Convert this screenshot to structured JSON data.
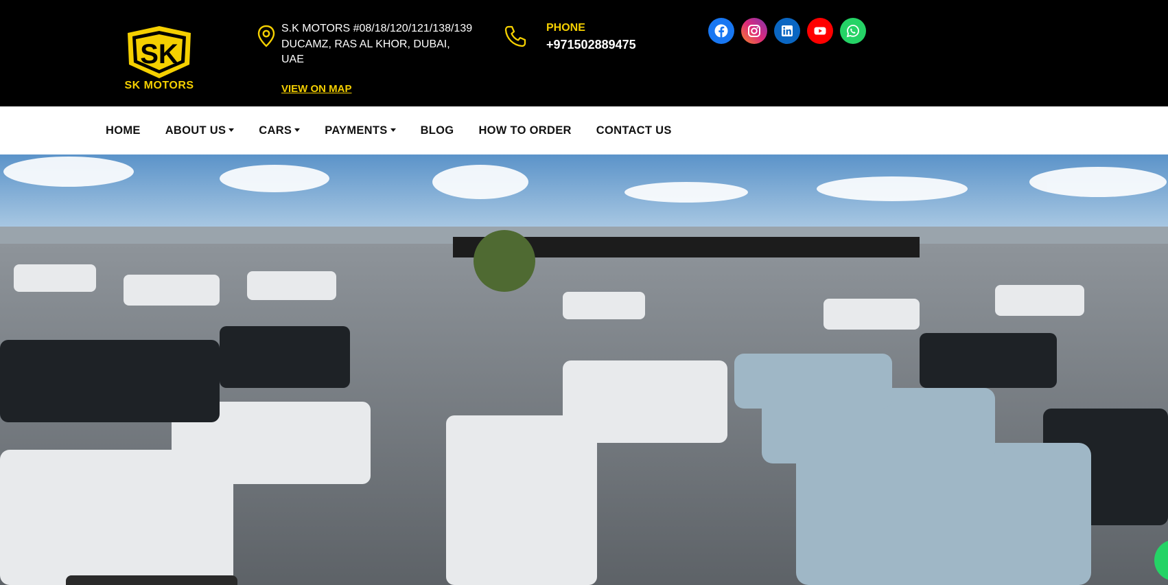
{
  "header": {
    "logo_mark": "SK",
    "logo_text": "SK MOTORS",
    "address_line1": "S.K MOTORS #08/18/120/121/138/139",
    "address_line2": "DUCAMZ, RAS AL KHOR, DUBAI,",
    "address_line3": "UAE",
    "map_link": "VIEW ON MAP",
    "phone_label": "PHONE",
    "phone_number": "+971502889475",
    "icons": {
      "address": "map-pin-icon",
      "phone": "phone-icon"
    },
    "socials": [
      {
        "name": "facebook",
        "icon": "facebook-icon",
        "color": "#1877f2"
      },
      {
        "name": "instagram",
        "icon": "instagram-icon",
        "color": "#c13584"
      },
      {
        "name": "linkedin",
        "icon": "linkedin-icon",
        "color": "#0a66c2"
      },
      {
        "name": "youtube",
        "icon": "youtube-icon",
        "color": "#ff0000"
      },
      {
        "name": "whatsapp",
        "icon": "whatsapp-icon",
        "color": "#25d366"
      }
    ]
  },
  "nav": {
    "items": [
      {
        "label": "HOME",
        "dropdown": false
      },
      {
        "label": "ABOUT US",
        "dropdown": true
      },
      {
        "label": "CARS",
        "dropdown": true
      },
      {
        "label": "PAYMENTS",
        "dropdown": true
      },
      {
        "label": "BLOG",
        "dropdown": false
      },
      {
        "label": "HOW TO ORDER",
        "dropdown": false
      },
      {
        "label": "CONTACT US",
        "dropdown": false
      }
    ]
  },
  "colors": {
    "accent": "#f5d000",
    "topbar": "#000000",
    "nav_text": "#111111"
  }
}
